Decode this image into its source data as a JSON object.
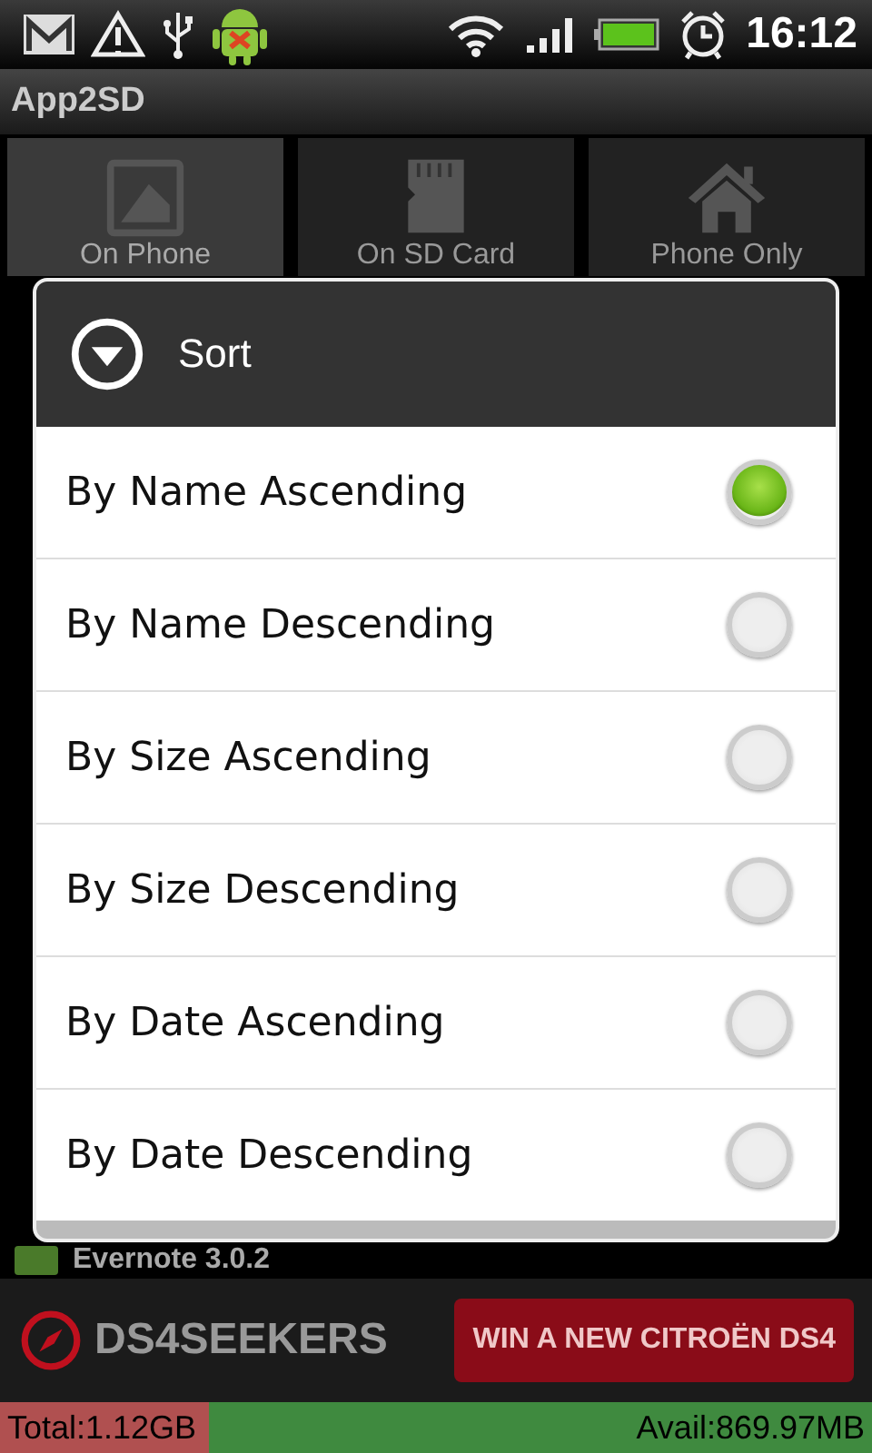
{
  "status_bar": {
    "time": "16:12"
  },
  "app_bar": {
    "title": "App2SD"
  },
  "tabs": [
    {
      "label": "On Phone",
      "selected": true
    },
    {
      "label": "On SD Card",
      "selected": false
    },
    {
      "label": "Phone Only",
      "selected": false
    }
  ],
  "app_list": {
    "items": [
      {
        "name": "Evernote 3.0.2"
      }
    ]
  },
  "ad_banner": {
    "brand": "DS4SEEKERS",
    "cta": "WIN A NEW CITROËN DS4"
  },
  "storage_bar": {
    "total": "Total:1.12GB",
    "available": "Avail:869.97MB",
    "level": 0.24
  },
  "dialog": {
    "title": "Sort",
    "options": [
      {
        "label": "By Name Ascending",
        "selected": true
      },
      {
        "label": "By Name Descending",
        "selected": false
      },
      {
        "label": "By Size Ascending",
        "selected": false
      },
      {
        "label": "By Size Descending",
        "selected": false
      },
      {
        "label": "By Date Ascending",
        "selected": false
      },
      {
        "label": "By Date Descending",
        "selected": false
      }
    ]
  }
}
